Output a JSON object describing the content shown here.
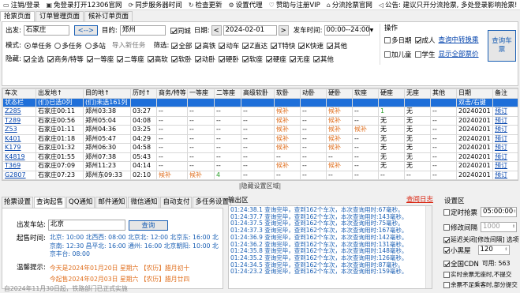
{
  "menu": [
    {
      "icon": "monitor-icon",
      "label": "注销/登录"
    },
    {
      "icon": "window-icon",
      "label": "免登录打开12306官网"
    },
    {
      "icon": "sync-icon",
      "label": "同步服务器时间"
    },
    {
      "icon": "refresh-icon",
      "label": "检查更新"
    },
    {
      "icon": "gear-icon",
      "label": "设置代理"
    },
    {
      "icon": "heart-icon",
      "label": "赞助与注册VIP"
    },
    {
      "icon": "home-icon",
      "label": "分流抢票官网"
    },
    {
      "icon": "speaker-icon",
      "label": "公告: 建议只开分流抢票, 多处登录影响抢票!"
    }
  ],
  "tabs": [
    "抢票页面",
    "订单管理页面",
    "候补订单页面"
  ],
  "query": {
    "from_label": "出发:",
    "from_value": "石家庄",
    "swap": "<-->",
    "to_label": "目的:",
    "to_value": "郑州",
    "same_city": "同城",
    "date_label": "日期:",
    "prev": "<",
    "date": "2024-02-01",
    "next": ">",
    "time_label": "发车时间:",
    "time": "00:00--24:00",
    "mode_label": "模式:",
    "modes": [
      "单任务",
      "多任务",
      "多站"
    ],
    "import": "导入新任务",
    "filter_label": "筛选:",
    "filters": [
      "全部",
      "高铁",
      "动车",
      "Z直达",
      "T特快",
      "K快速",
      "其他"
    ],
    "hide_label": "隐藏:",
    "hides": [
      "全选",
      "商务/特等",
      "一等座",
      "二等座",
      "高软",
      "软卧",
      "动卧",
      "硬卧",
      "软座",
      "硬座",
      "无座",
      "其他"
    ]
  },
  "op": {
    "title": "操作",
    "multi_date": "多日期",
    "adult": "成人",
    "query_transfer": "查询中转换乘",
    "child": "加儿童",
    "student": "学生",
    "show_all": "显示全部票价",
    "query_btn": "查询车票"
  },
  "table": {
    "headers": [
      "车次",
      "出发地↑",
      "目的地↑",
      "历时↑",
      "商务/特等",
      "一等座",
      "二等座",
      "高级软卧",
      "软卧",
      "动卧",
      "硬卧",
      "软座",
      "硬座",
      "无座",
      "其他",
      "日期",
      "备注"
    ],
    "status_row": [
      "状态栏",
      "(们)已选0列",
      "(们)未选161列",
      "",
      "",
      "",
      "",
      "",
      "",
      "",
      "",
      "",
      "",
      "",
      "",
      "双击/右键",
      ""
    ],
    "rows": [
      [
        "Z285",
        "石家庄00:11",
        "郑州03:38",
        "03:27",
        "--",
        "--",
        "--",
        "--",
        "候补",
        "--",
        "候补",
        "--",
        "1",
        "无",
        "--",
        "20240201",
        "预订"
      ],
      [
        "T289",
        "石家庄00:56",
        "郑州05:04",
        "04:08",
        "--",
        "--",
        "--",
        "--",
        "候补",
        "--",
        "候补",
        "--",
        "无",
        "无",
        "--",
        "20240201",
        "预订"
      ],
      [
        "Z53",
        "石家庄01:11",
        "郑州04:36",
        "03:25",
        "--",
        "--",
        "--",
        "--",
        "候补",
        "--",
        "候补",
        "候补",
        "无",
        "无",
        "--",
        "20240201",
        "预订"
      ],
      [
        "K401",
        "石家庄01:18",
        "郑州05:47",
        "04:29",
        "--",
        "--",
        "--",
        "--",
        "候补",
        "--",
        "候补",
        "--",
        "无",
        "无",
        "--",
        "20240201",
        "预订"
      ],
      [
        "K179",
        "石家庄01:32",
        "郑州06:30",
        "04:58",
        "--",
        "--",
        "--",
        "--",
        "候补",
        "--",
        "候补",
        "--",
        "无",
        "无",
        "--",
        "20240201",
        "预订"
      ],
      [
        "K4819",
        "石家庄01:55",
        "郑州07:38",
        "05:43",
        "--",
        "--",
        "--",
        "--",
        "--",
        "--",
        "--",
        "--",
        "无",
        "无",
        "--",
        "20240201",
        "预订"
      ],
      [
        "T369",
        "石家庄07:09",
        "郑州11:23",
        "04:14",
        "--",
        "--",
        "--",
        "--",
        "候补",
        "--",
        "候补",
        "--",
        "无",
        "无",
        "--",
        "20240201",
        "预订"
      ],
      [
        "G2807",
        "石家庄07:23",
        "郑州东09:33",
        "02:10",
        "候补",
        "候补",
        "4",
        "--",
        "--",
        "--",
        "--",
        "--",
        "--",
        "--",
        "--",
        "20240201",
        "预订"
      ]
    ]
  },
  "divider": "|隐藏设置区域|",
  "bottom_tabs": [
    "抢票设置",
    "查询起售",
    "QQ通知",
    "邮件通知",
    "微信通知",
    "自动支付",
    "多任务设置"
  ],
  "sale": {
    "station_label": "出发车站:",
    "station": "北京",
    "query": "查询",
    "time_label": "起售时间:",
    "times": "北京: 10:00  北西西: 08:00  北京北: 12:00  北京东: 16:00  北京南: 12:30  昌平北: 16:00  通州: 16:00  北京朝阳: 10:00  北京丰台: 08:00",
    "tip_label": "温馨提示:",
    "tip1": "今天是2024年01月20日 星期六  【农历】腊月初十",
    "tip2": "今起售2024年02月03日 星期六  【农历】腊月廿四",
    "tip3": "自2024年11月30日起，铁路部门已正式实施"
  },
  "output": {
    "title": "输出区",
    "log_link": "查阅日志",
    "lines": [
      "01:24:38.1  查询完毕，查到162个车次，本次查询用时:67毫秒。",
      "01:24:37.7  查询完毕，查到162个车次，本次查询用时:143毫秒。",
      "01:24:37.5  查询完毕，查到162个车次，本次查询用时:75毫秒。",
      "01:24:37.3  查询完毕，查到162个车次，本次查询用时:167毫秒。",
      "01:24:36.9  查询完毕，查到162个车次，本次查询用时:142毫秒。",
      "01:24:36.2  查询完毕，查到162个车次，本次查询用时:131毫秒。",
      "01:24:35.8  查询完毕，查到162个车次，本次查询用时:148毫秒。",
      "01:24:35.2  查询完毕，查到162个车次，本次查询用时:126毫秒。",
      "01:24:34.5  查询完毕，查到162个车次，本次查询用时:87毫秒。",
      "01:24:23.2  查询完毕，查到162个车次，本次查询用时:159毫秒。"
    ]
  },
  "settings": {
    "title": "设置区",
    "timed": "定时抢票",
    "timed_val": "05:00:00",
    "interval": "修改间隔",
    "interval_val": "1000",
    "delay": "延迟关闭[修改间隔] 选项",
    "minheap": "小黑屋",
    "minheap_val": "120",
    "cdn": "全国CDN",
    "cdn_avail": "可用: 563",
    "realtime": "实时余票无座时,不提交",
    "partial": "余票不足乘客时,部分提交"
  }
}
